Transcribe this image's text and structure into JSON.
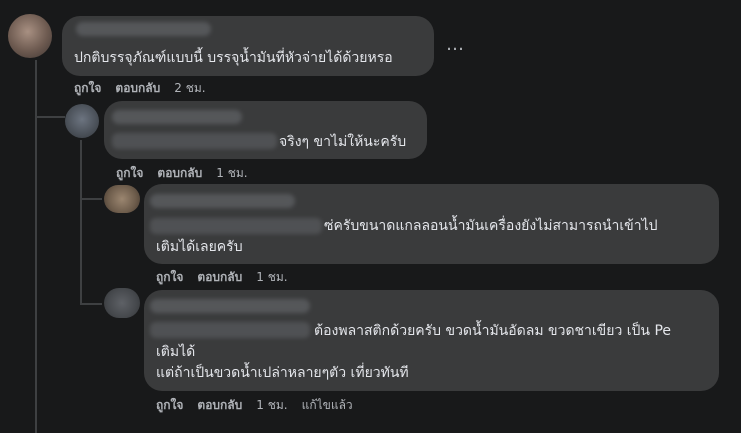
{
  "comments": [
    {
      "text_lines": [
        "ปกติบรรจุภัณฑ์แบบนี้ บรรจุน้ำมันที่หัวจ่ายได้ด้วยหรอ"
      ],
      "like": "ถูกใจ",
      "reply": "ตอบกลับ",
      "time": "2 ชม.",
      "more": "…"
    },
    {
      "text_lines": [
        "จริงๆ ขาไม่ให้นะครับ"
      ],
      "like": "ถูกใจ",
      "reply": "ตอบกลับ",
      "time": "1 ชม."
    },
    {
      "text_lines": [
        "ซ่ครับขนาดแกลลอนน้ำมันเครื่องยังไม่สามารถนำเข้าไป",
        "เติมได้เลยครับ"
      ],
      "like": "ถูกใจ",
      "reply": "ตอบกลับ",
      "time": "1 ชม."
    },
    {
      "text_lines": [
        "ต้องพลาสติกด้วยครับ ขวดน้ำมันอัดลม ขวดชาเขียว เป็น Pe",
        "เติมได้",
        "แต่ถ้าเป็นขวดน้ำเปล่าหลายๆตัว เที่ยวทันที"
      ],
      "like": "ถูกใจ",
      "reply": "ตอบกลับ",
      "time": "1 ชม.",
      "edited": "แก้ไขแล้ว"
    }
  ]
}
